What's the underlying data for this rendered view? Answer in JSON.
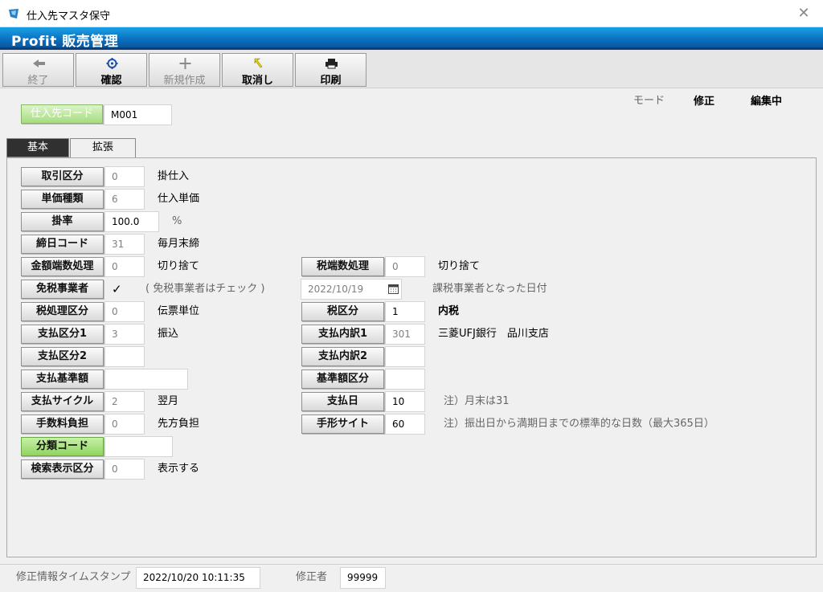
{
  "window": {
    "title": "仕入先マスタ保守",
    "close_glyph": "✕"
  },
  "banner": {
    "text": "Profit 販売管理"
  },
  "toolbar": {
    "end": {
      "label": "終了",
      "icon": "back-arrow-icon"
    },
    "confirm": {
      "label": "確認",
      "icon": "gear-icon"
    },
    "new": {
      "label": "新規作成",
      "icon": "plus-icon"
    },
    "cancel": {
      "label": "取消し",
      "icon": "undo-icon"
    },
    "print": {
      "label": "印刷",
      "icon": "printer-icon"
    }
  },
  "header": {
    "supplier_code_label": "仕入先コード",
    "supplier_code_value": "M001",
    "mode_label": "モード",
    "mode_value": "修正",
    "status_value": "編集中"
  },
  "tabs": [
    {
      "label": "基本",
      "active": false
    },
    {
      "label": "拡張",
      "active": true
    }
  ],
  "fields": {
    "torihiki_kubun": {
      "label": "取引区分",
      "value": "0",
      "desc": "掛仕入"
    },
    "tanka_shurui": {
      "label": "単価種類",
      "value": "6",
      "desc": "仕入単価"
    },
    "kakeritsu": {
      "label": "掛率",
      "value": "100.0",
      "desc": "%"
    },
    "shimebi_code": {
      "label": "締日コード",
      "value": "31",
      "desc": "毎月末締"
    },
    "kingaku_hasu": {
      "label": "金額端数処理",
      "value": "0",
      "desc": "切り捨て"
    },
    "zei_hasu": {
      "label": "税端数処理",
      "value": "0",
      "desc": "切り捨て"
    },
    "menzei": {
      "label": "免税事業者",
      "value": "✓",
      "desc": "( 免税事業者はチェック )"
    },
    "kazei_date": {
      "value": "2022/10/19",
      "desc": "課税事業者となった日付",
      "icon": "calendar-icon"
    },
    "zei_shori_kubun": {
      "label": "税処理区分",
      "value": "0",
      "desc": "伝票単位"
    },
    "zei_kubun": {
      "label": "税区分",
      "value": "1",
      "desc": "内税"
    },
    "shiharai_kubun1": {
      "label": "支払区分1",
      "value": "3",
      "desc": "振込"
    },
    "shiharai_uchiwake1": {
      "label": "支払内訳1",
      "value": "301",
      "desc": "三菱UFJ銀行　品川支店"
    },
    "shiharai_kubun2": {
      "label": "支払区分2",
      "value": ""
    },
    "shiharai_uchiwake2": {
      "label": "支払内訳2",
      "value": ""
    },
    "shiharai_kijungaku": {
      "label": "支払基準額",
      "value": ""
    },
    "kijungaku_kubun": {
      "label": "基準額区分",
      "value": ""
    },
    "shiharai_cycle": {
      "label": "支払サイクル",
      "value": "2",
      "desc": "翌月"
    },
    "shiharai_bi": {
      "label": "支払日",
      "value": "10",
      "desc": "注）月末は31"
    },
    "tesuryo_futan": {
      "label": "手数料負担",
      "value": "0",
      "desc": "先方負担"
    },
    "tegata_site": {
      "label": "手形サイト",
      "value": "60",
      "desc": "注）振出日から満期日までの標準的な日数（最大365日）"
    },
    "bunrui_code": {
      "label": "分類コード",
      "value": ""
    },
    "kensaku_hyoji": {
      "label": "検索表示区分",
      "value": "0",
      "desc": "表示する"
    }
  },
  "status": {
    "timestamp_label": "修正情報タイムスタンプ",
    "timestamp_value": "2022/10/20 10:11:35",
    "editor_label": "修正者",
    "editor_value": "99999"
  }
}
